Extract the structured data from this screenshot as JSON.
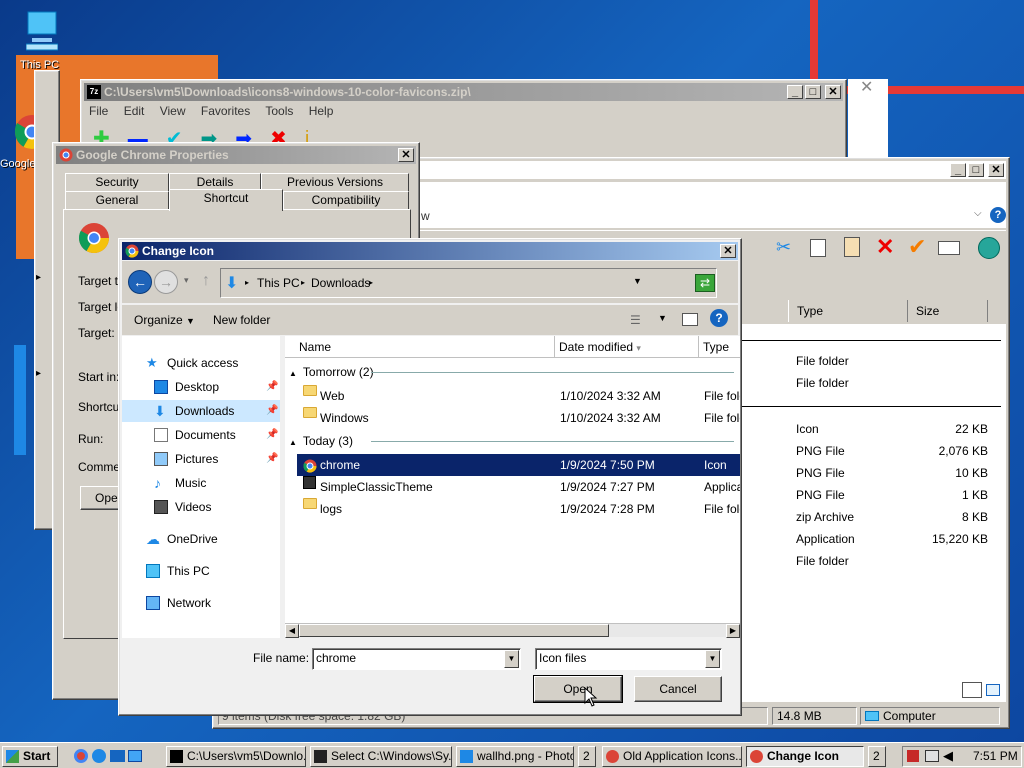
{
  "desktop": {
    "icons": [
      {
        "label": "This PC",
        "icon": "computer-icon"
      },
      {
        "label": "Google",
        "icon": "chrome-icon"
      }
    ]
  },
  "zip_window": {
    "title": "C:\\Users\\vm5\\Downloads\\icons8-windows-10-color-favicons.zip\\",
    "menu": [
      "File",
      "Edit",
      "View",
      "Favorites",
      "Tools",
      "Help"
    ]
  },
  "explorer_window": {
    "address_tail": "w",
    "columns": [
      "Type",
      "Size"
    ],
    "rows": [
      {
        "type": "File folder",
        "size": ""
      },
      {
        "type": "File folder",
        "size": ""
      },
      {
        "type": "Icon",
        "size": "22 KB"
      },
      {
        "type": "PNG File",
        "size": "2,076 KB"
      },
      {
        "type": "PNG File",
        "size": "10 KB"
      },
      {
        "type": "PNG File",
        "size": "1 KB"
      },
      {
        "type": "zip Archive",
        "size": "8 KB"
      },
      {
        "type": "Application",
        "size": "15,220 KB"
      },
      {
        "type": "File folder",
        "size": ""
      }
    ],
    "status_left": "9 items (Disk free space: 1.82 GB)",
    "status_size": "14.8 MB",
    "status_location": "Computer"
  },
  "props_window": {
    "title": "Google Chrome Properties",
    "tabs_back": [
      "Security",
      "Details",
      "Previous Versions"
    ],
    "tabs_front": [
      "General",
      "Shortcut",
      "Compatibility"
    ],
    "labels": [
      "Target ty",
      "Target lo",
      "Target:",
      "Start in:",
      "Shortcut",
      "Run:",
      "Commen"
    ],
    "open_btn": "Oper"
  },
  "dialog": {
    "title": "Change Icon",
    "breadcrumb": [
      "This PC",
      "Downloads"
    ],
    "organize": "Organize",
    "new_folder": "New folder",
    "nav": [
      {
        "label": "Quick access",
        "icon": "star-icon"
      },
      {
        "label": "Desktop",
        "icon": "desktop-icon",
        "pin": true
      },
      {
        "label": "Downloads",
        "icon": "download-icon",
        "pin": true,
        "selected": true
      },
      {
        "label": "Documents",
        "icon": "documents-icon",
        "pin": true
      },
      {
        "label": "Pictures",
        "icon": "pictures-icon",
        "pin": true
      },
      {
        "label": "Music",
        "icon": "music-icon"
      },
      {
        "label": "Videos",
        "icon": "videos-icon"
      },
      {
        "label": "OneDrive",
        "icon": "cloud-icon"
      },
      {
        "label": "This PC",
        "icon": "computer-icon"
      },
      {
        "label": "Network",
        "icon": "network-icon"
      }
    ],
    "columns": [
      "Name",
      "Date modified",
      "Type"
    ],
    "groups": [
      {
        "label": "Tomorrow (2)",
        "items": [
          {
            "name": "Web",
            "date": "1/10/2024 3:32 AM",
            "type": "File fold",
            "icon": "folder-icon"
          },
          {
            "name": "Windows",
            "date": "1/10/2024 3:32 AM",
            "type": "File fold",
            "icon": "folder-icon"
          }
        ]
      },
      {
        "label": "Today (3)",
        "items": [
          {
            "name": "chrome",
            "date": "1/9/2024 7:50 PM",
            "type": "Icon",
            "icon": "chrome-icon",
            "selected": true
          },
          {
            "name": "SimpleClassicTheme",
            "date": "1/9/2024 7:27 PM",
            "type": "Applicat",
            "icon": "app-icon"
          },
          {
            "name": "logs",
            "date": "1/9/2024 7:28 PM",
            "type": "File fold",
            "icon": "folder-icon"
          }
        ]
      }
    ],
    "filename_label": "File name:",
    "filename_value": "chrome",
    "filter_value": "Icon files",
    "open_label": "Open",
    "cancel_label": "Cancel"
  },
  "taskbar": {
    "start": "Start",
    "buttons": [
      {
        "label": "C:\\Users\\vm5\\Downlo...",
        "icon": "7zip-icon"
      },
      {
        "label": "Select C:\\Windows\\Sy...",
        "icon": "cmd-icon"
      },
      {
        "label": "wallhd.png - Photos",
        "icon": "photos-icon"
      },
      {
        "label": "2",
        "icon": ""
      },
      {
        "label": "Old Application Icons...",
        "icon": "chrome-icon"
      },
      {
        "label": "Change Icon",
        "icon": "chrome-icon",
        "active": true
      },
      {
        "label": "2",
        "icon": ""
      }
    ],
    "time": "7:51 PM"
  }
}
